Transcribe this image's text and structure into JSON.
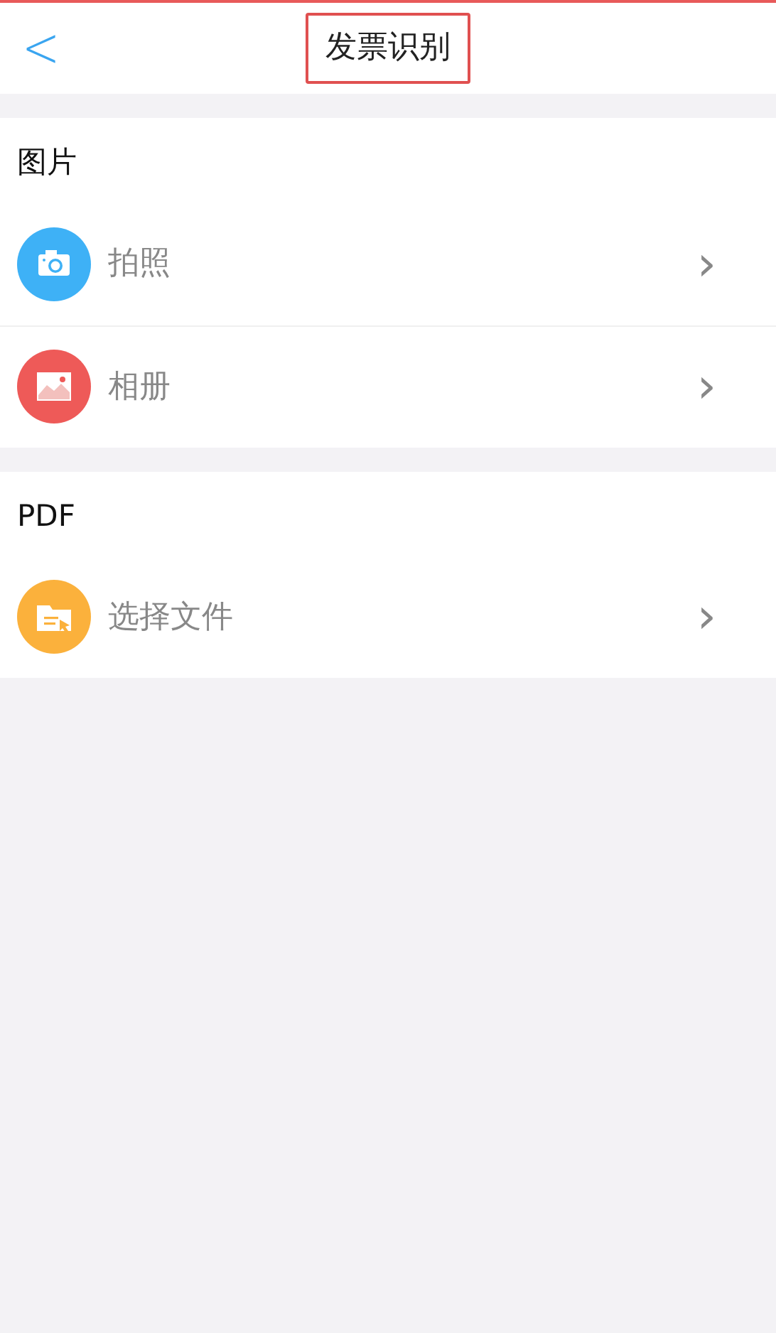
{
  "header": {
    "back": "<",
    "title": "发票识别"
  },
  "sections": [
    {
      "title": "图片",
      "items": [
        {
          "kind": "camera",
          "label": "拍照",
          "color": "#3eb1f6",
          "chevron": "›"
        },
        {
          "kind": "album",
          "label": "相册",
          "color": "#ee5a58",
          "chevron": "›"
        }
      ]
    },
    {
      "title": "PDF",
      "items": [
        {
          "kind": "file",
          "label": "选择文件",
          "color": "#fbb13c",
          "chevron": "›"
        }
      ]
    }
  ]
}
